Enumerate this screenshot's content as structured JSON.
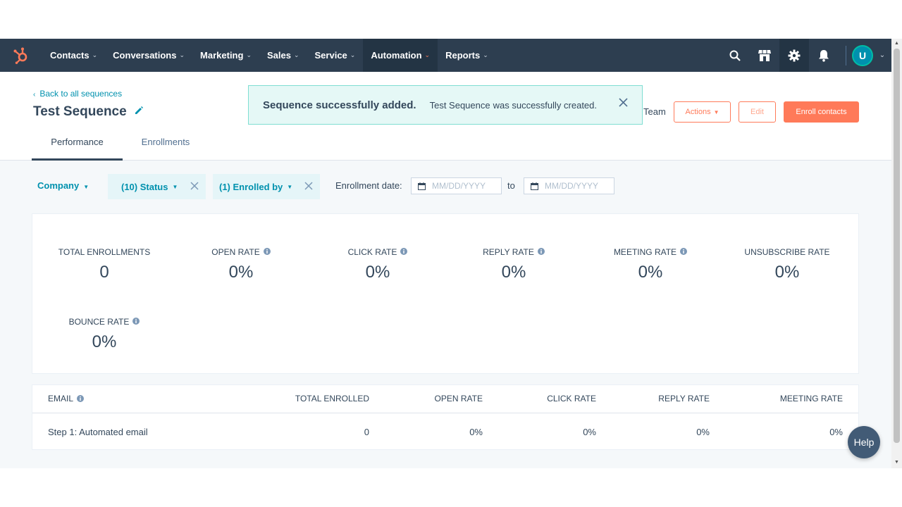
{
  "nav": {
    "logo_icon": "hubspot-sprocket-icon",
    "items": [
      {
        "label": "Contacts"
      },
      {
        "label": "Conversations"
      },
      {
        "label": "Marketing"
      },
      {
        "label": "Sales"
      },
      {
        "label": "Service"
      },
      {
        "label": "Automation",
        "active": true
      },
      {
        "label": "Reports"
      }
    ],
    "right_icons": [
      "search-icon",
      "marketplace-icon",
      "settings-gear-icon",
      "notifications-bell-icon"
    ],
    "avatar_initial": "U"
  },
  "header": {
    "back_link": "Back to all sequences",
    "title": "Test Sequence",
    "team_label": "Team",
    "actions_label": "Actions",
    "edit_label": "Edit",
    "enroll_label": "Enroll contacts"
  },
  "toast": {
    "title": "Sequence successfully added.",
    "sequence_name": "Test Sequence",
    "message": "was successfully created."
  },
  "tabs": [
    {
      "label": "Performance",
      "active": true
    },
    {
      "label": "Enrollments",
      "active": false
    }
  ],
  "filters": {
    "company": "Company",
    "status": "(10) Status",
    "enrolled_by": "(1) Enrolled by",
    "enrollment_date_label": "Enrollment date:",
    "date_placeholder": "MM/DD/YYYY",
    "to_label": "to"
  },
  "stats": [
    {
      "label": "TOTAL ENROLLMENTS",
      "value": "0",
      "info": false
    },
    {
      "label": "OPEN RATE",
      "value": "0%",
      "info": true
    },
    {
      "label": "CLICK RATE",
      "value": "0%",
      "info": true
    },
    {
      "label": "REPLY RATE",
      "value": "0%",
      "info": true
    },
    {
      "label": "MEETING RATE",
      "value": "0%",
      "info": true
    },
    {
      "label": "UNSUBSCRIBE RATE",
      "value": "0%",
      "info": false
    },
    {
      "label": "BOUNCE RATE",
      "value": "0%",
      "info": true
    }
  ],
  "table": {
    "headers": [
      "EMAIL",
      "TOTAL ENROLLED",
      "OPEN RATE",
      "CLICK RATE",
      "REPLY RATE",
      "MEETING RATE"
    ],
    "rows": [
      [
        "Step 1: Automated email",
        "0",
        "0%",
        "0%",
        "0%",
        "0%"
      ]
    ]
  },
  "help_label": "Help",
  "colors": {
    "nav_bg": "#2d3e50",
    "accent_orange": "#ff7a59",
    "link_teal": "#0091ae",
    "toast_bg": "#e5f8f6"
  }
}
